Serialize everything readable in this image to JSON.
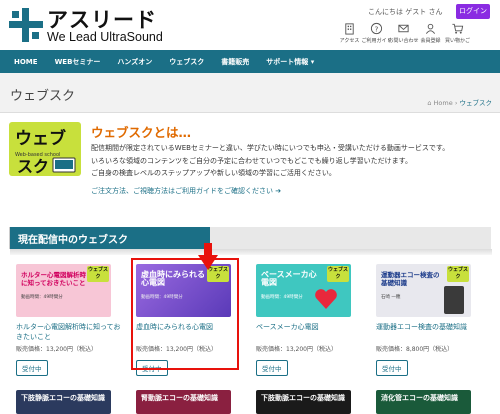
{
  "header": {
    "logo_title": "アスリード",
    "logo_sub": "We Lead UltraSound",
    "greeting": "こんにちは ゲスト さん",
    "login_label": "ログイン",
    "icons": [
      {
        "icon": "building-icon",
        "label": "アクセス"
      },
      {
        "icon": "question-icon",
        "label": "ご利用ガイド"
      },
      {
        "icon": "mail-icon",
        "label": "お問い合わせ"
      },
      {
        "icon": "user-icon",
        "label": "会員登録"
      },
      {
        "icon": "cart-icon",
        "label": "買い物かご"
      }
    ]
  },
  "nav": [
    "HOME",
    "WEBセミナー",
    "ハンズオン",
    "ウェブスク",
    "書籍販売",
    "サポート情報 ▾"
  ],
  "page": {
    "title": "ウェブスク",
    "breadcrumb_home": "Home",
    "breadcrumb_sep": "›",
    "breadcrumb_current": "ウェブスク"
  },
  "intro": {
    "badge_text_1": "ウェブ",
    "badge_text_2": "スク",
    "badge_sub": "Web-based school",
    "title": "ウェブスクとは…",
    "line1": "配信期間が限定されているWEBセミナーと違い、学びたい時にいつでも申込・受講いただける動画サービスです。",
    "line2": "いろいろな領域のコンテンツをご自分の予定に合わせていつでもどこでも繰り返し学習いただけます。",
    "line3": "ご自身の検査レベルのステップアップや新しい領域の学習にご活用ください。",
    "link": "ご注文方法、ご視聴方法はご利用ガイドをご確認ください"
  },
  "section": {
    "title": "現在配信中のウェブスク"
  },
  "colors": {
    "accent": "#1b6f86",
    "highlight": "#e8120c",
    "brand_orange": "#e06a00"
  },
  "cards": [
    {
      "thumb_title": "ホルター心電図解析時に知っておきたいこと",
      "thumb_meta": "動画時間：49時間分",
      "badge": "ウェブスク",
      "name": "ホルター心電図解析時に知っておきたいこと",
      "price": "販売価格：13,200円（税込）",
      "button": "受付中",
      "bg": "#f7c6d6",
      "title_color": "#d1005e"
    },
    {
      "thumb_title": "虚血時にみられる心電図",
      "thumb_meta": "動画時間：49時間分",
      "badge": "ウェブスク",
      "name": "虚血時にみられる心電図",
      "price": "販売価格：13,200円（税込）",
      "button": "受付中",
      "bg": "#7b4fd0",
      "title_color": "#ffffff"
    },
    {
      "thumb_title": "ペースメーカ心電図",
      "thumb_meta": "動画時間：49時間分",
      "badge": "ウェブスク",
      "name": "ペースメーカ心電図",
      "price": "販売価格：13,200円（税込）",
      "button": "受付中",
      "bg": "#3fc7c0",
      "title_color": "#ffffff"
    },
    {
      "thumb_title": "運動器エコー検査の基礎知識",
      "thumb_meta": "石崎 一穂",
      "badge": "ウェブスク",
      "name": "運動器エコー検査の基礎知識",
      "price": "販売価格：8,800円（税込）",
      "button": "受付中",
      "bg": "#e8e8ee",
      "title_color": "#1a3a8a"
    }
  ],
  "bottom_cards": [
    {
      "title": "下肢静脈エコーの基礎知識",
      "bg": "#2b3a5e"
    },
    {
      "title": "腎動脈エコーの基礎知識",
      "bg": "#8a2040"
    },
    {
      "title": "下肢動脈エコーの基礎知識",
      "bg": "#1a1a1a"
    },
    {
      "title": "消化管エコーの基礎知識",
      "bg": "#1a5a3a"
    }
  ]
}
